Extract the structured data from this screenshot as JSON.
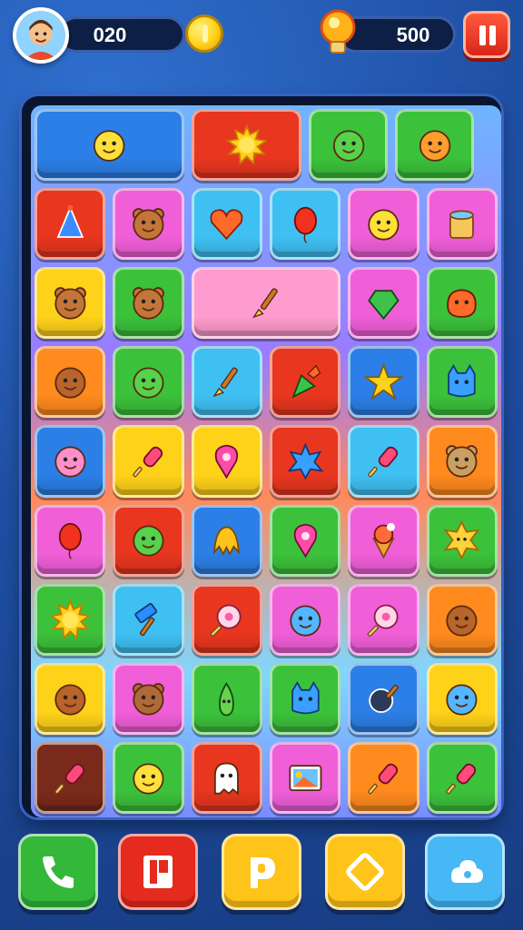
{
  "hud": {
    "coins": "020",
    "score": "500"
  },
  "colors": {
    "red": "#e8361f",
    "blue": "#2c7fe6",
    "green": "#3cc13b",
    "pink": "#f05fd8",
    "yellow": "#ffd21a",
    "orange": "#ff8a1e",
    "cyan": "#3fc0f2",
    "brown": "#7a2a1a",
    "lightpink": "#ff9ccf"
  },
  "board": {
    "tiles": [
      {
        "row": 0,
        "col": 0,
        "span": 2,
        "color": "blue",
        "icon": "yellow-face-icon"
      },
      {
        "row": 0,
        "col": 2,
        "span": 1.5,
        "color": "red",
        "icon": "sun-icon"
      },
      {
        "row": 0,
        "col": 3.5,
        "span": 1.1,
        "color": "green",
        "icon": "green-face-icon"
      },
      {
        "row": 0,
        "col": 4.6,
        "span": 1.1,
        "color": "green",
        "icon": "orange-face-icon"
      },
      {
        "row": 1,
        "col": 0,
        "span": 1,
        "color": "red",
        "icon": "party-hat-icon"
      },
      {
        "row": 1,
        "col": 1,
        "span": 1,
        "color": "pink",
        "icon": "bear-icon"
      },
      {
        "row": 1,
        "col": 2,
        "span": 1,
        "color": "cyan",
        "icon": "heart-icon"
      },
      {
        "row": 1,
        "col": 3,
        "span": 1,
        "color": "cyan",
        "icon": "balloon-icon"
      },
      {
        "row": 1,
        "col": 4,
        "span": 1,
        "color": "pink",
        "icon": "yellow-face-icon"
      },
      {
        "row": 1,
        "col": 5,
        "span": 1,
        "color": "pink",
        "icon": "drum-icon"
      },
      {
        "row": 2,
        "col": 0,
        "span": 1,
        "color": "yellow",
        "icon": "bear-icon"
      },
      {
        "row": 2,
        "col": 1,
        "span": 1,
        "color": "green",
        "icon": "bear-icon"
      },
      {
        "row": 2,
        "col": 2,
        "span": 2,
        "color": "lightpink",
        "icon": "brush-icon"
      },
      {
        "row": 2,
        "col": 4,
        "span": 1,
        "color": "pink",
        "icon": "gem-icon"
      },
      {
        "row": 2,
        "col": 5,
        "span": 1,
        "color": "green",
        "icon": "blob-icon"
      },
      {
        "row": 3,
        "col": 0,
        "span": 1,
        "color": "orange",
        "icon": "monkey-icon"
      },
      {
        "row": 3,
        "col": 1,
        "span": 1,
        "color": "green",
        "icon": "green-face-icon"
      },
      {
        "row": 3,
        "col": 2,
        "span": 1,
        "color": "cyan",
        "icon": "brush-icon"
      },
      {
        "row": 3,
        "col": 3,
        "span": 1,
        "color": "red",
        "icon": "carrot-icon"
      },
      {
        "row": 3,
        "col": 4,
        "span": 1,
        "color": "blue",
        "icon": "star-icon"
      },
      {
        "row": 3,
        "col": 5,
        "span": 1,
        "color": "green",
        "icon": "cat-icon"
      },
      {
        "row": 4,
        "col": 0,
        "span": 1,
        "color": "blue",
        "icon": "pink-face-icon"
      },
      {
        "row": 4,
        "col": 1,
        "span": 1,
        "color": "yellow",
        "icon": "popsicle-icon"
      },
      {
        "row": 4,
        "col": 2,
        "span": 1,
        "color": "yellow",
        "icon": "pin-icon"
      },
      {
        "row": 4,
        "col": 3,
        "span": 1,
        "color": "red",
        "icon": "splash-icon"
      },
      {
        "row": 4,
        "col": 4,
        "span": 1,
        "color": "cyan",
        "icon": "popsicle-icon"
      },
      {
        "row": 4,
        "col": 5,
        "span": 1,
        "color": "orange",
        "icon": "elephant-icon"
      },
      {
        "row": 5,
        "col": 0,
        "span": 1,
        "color": "pink",
        "icon": "balloon-icon"
      },
      {
        "row": 5,
        "col": 1,
        "span": 1,
        "color": "red",
        "icon": "green-face-icon"
      },
      {
        "row": 5,
        "col": 2,
        "span": 1,
        "color": "blue",
        "icon": "octopus-icon"
      },
      {
        "row": 5,
        "col": 3,
        "span": 1,
        "color": "green",
        "icon": "pin-icon"
      },
      {
        "row": 5,
        "col": 4,
        "span": 1,
        "color": "pink",
        "icon": "ice-cream-icon"
      },
      {
        "row": 5,
        "col": 5,
        "span": 1,
        "color": "green",
        "icon": "sun-face-icon"
      },
      {
        "row": 6,
        "col": 0,
        "span": 1,
        "color": "green",
        "icon": "sun-icon"
      },
      {
        "row": 6,
        "col": 1,
        "span": 1,
        "color": "cyan",
        "icon": "hammer-icon"
      },
      {
        "row": 6,
        "col": 2,
        "span": 1,
        "color": "red",
        "icon": "lollipop-icon"
      },
      {
        "row": 6,
        "col": 3,
        "span": 1,
        "color": "pink",
        "icon": "blue-face-icon"
      },
      {
        "row": 6,
        "col": 4,
        "span": 1,
        "color": "pink",
        "icon": "lollipop-icon"
      },
      {
        "row": 6,
        "col": 5,
        "span": 1,
        "color": "orange",
        "icon": "monkey-icon"
      },
      {
        "row": 7,
        "col": 0,
        "span": 1,
        "color": "yellow",
        "icon": "monkey-icon"
      },
      {
        "row": 7,
        "col": 1,
        "span": 1,
        "color": "pink",
        "icon": "mouse-icon"
      },
      {
        "row": 7,
        "col": 2,
        "span": 1,
        "color": "green",
        "icon": "pear-icon"
      },
      {
        "row": 7,
        "col": 3,
        "span": 1,
        "color": "green",
        "icon": "cat-icon"
      },
      {
        "row": 7,
        "col": 4,
        "span": 1,
        "color": "blue",
        "icon": "pan-icon"
      },
      {
        "row": 7,
        "col": 5,
        "span": 1,
        "color": "yellow",
        "icon": "blue-face-icon"
      },
      {
        "row": 8,
        "col": 0,
        "span": 1,
        "color": "brown",
        "icon": "popsicle-icon"
      },
      {
        "row": 8,
        "col": 1,
        "span": 1,
        "color": "green",
        "icon": "yellow-face-icon"
      },
      {
        "row": 8,
        "col": 2,
        "span": 1,
        "color": "red",
        "icon": "ghost-icon"
      },
      {
        "row": 8,
        "col": 3,
        "span": 1,
        "color": "pink",
        "icon": "picture-icon"
      },
      {
        "row": 8,
        "col": 4,
        "span": 1,
        "color": "orange",
        "icon": "popsicle-icon"
      },
      {
        "row": 8,
        "col": 5,
        "span": 1,
        "color": "green",
        "icon": "popsicle-icon"
      }
    ]
  },
  "bottom_bar": [
    {
      "name": "phone-button",
      "color": "#33b83a",
      "icon": "phone-icon"
    },
    {
      "name": "book-button",
      "color": "#e52a1e",
      "icon": "book-icon"
    },
    {
      "name": "hint-button",
      "color": "#ffc41a",
      "icon": "p-icon"
    },
    {
      "name": "shuffle-button",
      "color": "#ffc41a",
      "icon": "shuffle-icon"
    },
    {
      "name": "settings-button",
      "color": "#45b8f5",
      "icon": "gear-icon"
    }
  ]
}
